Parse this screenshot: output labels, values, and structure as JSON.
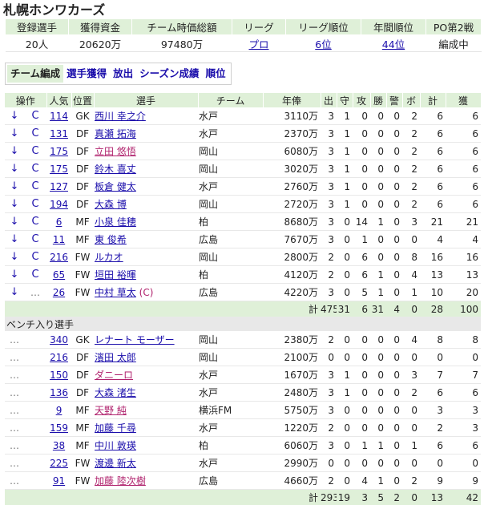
{
  "team_name": "札幌ホンワカーズ",
  "summary": {
    "headers": [
      "登録選手",
      "獲得資金",
      "チーム時価総額",
      "リーグ",
      "リーグ順位",
      "年間順位",
      "PO第2戦"
    ],
    "values": [
      "20人",
      "20620万",
      "97480万",
      "プロ",
      "6位",
      "44位",
      "編成中"
    ]
  },
  "tabs": [
    "チーム編成",
    "選手獲得",
    "放出",
    "シーズン成績",
    "順位"
  ],
  "columns": [
    "操作",
    "人気",
    "位置",
    "選手",
    "チーム",
    "年俸",
    "出",
    "守",
    "攻",
    "勝",
    "警",
    "ボ",
    "計",
    "獲"
  ],
  "starters": [
    {
      "ops": [
        "↓",
        "C"
      ],
      "pop": "114",
      "pos": "GK",
      "name": "西川 幸之介",
      "team": "水戸",
      "salary": "3110万",
      "stats": [
        "3",
        "1",
        "0",
        "0",
        "0",
        "2",
        "6",
        "6"
      ]
    },
    {
      "ops": [
        "↓",
        "C"
      ],
      "pop": "131",
      "pos": "DF",
      "name": "真瀬 拓海",
      "team": "水戸",
      "salary": "2370万",
      "stats": [
        "3",
        "1",
        "0",
        "0",
        "0",
        "2",
        "6",
        "6"
      ]
    },
    {
      "ops": [
        "↓",
        "C"
      ],
      "pop": "175",
      "pos": "DF",
      "name": "立田 悠悟",
      "team": "岡山",
      "salary": "6080万",
      "stats": [
        "3",
        "1",
        "0",
        "0",
        "0",
        "2",
        "6",
        "6"
      ],
      "pink": true
    },
    {
      "ops": [
        "↓",
        "C"
      ],
      "pop": "175",
      "pos": "DF",
      "name": "鈴木 喜丈",
      "team": "岡山",
      "salary": "3020万",
      "stats": [
        "3",
        "1",
        "0",
        "0",
        "0",
        "2",
        "6",
        "6"
      ]
    },
    {
      "ops": [
        "↓",
        "C"
      ],
      "pop": "127",
      "pos": "DF",
      "name": "板倉 健太",
      "team": "水戸",
      "salary": "2760万",
      "stats": [
        "3",
        "1",
        "0",
        "0",
        "0",
        "2",
        "6",
        "6"
      ]
    },
    {
      "ops": [
        "↓",
        "C"
      ],
      "pop": "194",
      "pos": "DF",
      "name": "大森 博",
      "team": "岡山",
      "salary": "2720万",
      "stats": [
        "3",
        "1",
        "0",
        "0",
        "0",
        "2",
        "6",
        "6"
      ]
    },
    {
      "ops": [
        "↓",
        "C"
      ],
      "pop": "6",
      "pos": "MF",
      "name": "小泉 佳穂",
      "team": "柏",
      "salary": "8680万",
      "stats": [
        "3",
        "0",
        "14",
        "1",
        "0",
        "3",
        "21",
        "21"
      ]
    },
    {
      "ops": [
        "↓",
        "C"
      ],
      "pop": "11",
      "pos": "MF",
      "name": "東 俊希",
      "team": "広島",
      "salary": "7670万",
      "stats": [
        "3",
        "0",
        "1",
        "0",
        "0",
        "0",
        "4",
        "4"
      ]
    },
    {
      "ops": [
        "↓",
        "C"
      ],
      "pop": "216",
      "pos": "FW",
      "name": "ルカオ",
      "team": "岡山",
      "salary": "2800万",
      "stats": [
        "2",
        "0",
        "6",
        "0",
        "0",
        "8",
        "16",
        "16"
      ]
    },
    {
      "ops": [
        "↓",
        "C"
      ],
      "pop": "65",
      "pos": "FW",
      "name": "垣田 裕暉",
      "team": "柏",
      "salary": "4120万",
      "stats": [
        "2",
        "0",
        "6",
        "1",
        "0",
        "4",
        "13",
        "13"
      ]
    },
    {
      "ops": [
        "↓",
        "…"
      ],
      "pop": "26",
      "pos": "FW",
      "name": "中村 草太",
      "captain": "(C)",
      "team": "広島",
      "salary": "4220万",
      "stats": [
        "3",
        "0",
        "5",
        "1",
        "0",
        "1",
        "10",
        "20"
      ]
    }
  ],
  "starters_total": {
    "label": "計",
    "salary": "47550万",
    "stats": [
      "31",
      "6",
      "31",
      "4",
      "0",
      "28",
      "100",
      "110"
    ]
  },
  "bench_title": "ベンチ入り選手",
  "bench": [
    {
      "ops": [
        "…",
        ""
      ],
      "pop": "340",
      "pos": "GK",
      "name": "レナート モーザー",
      "team": "岡山",
      "salary": "2380万",
      "stats": [
        "2",
        "0",
        "0",
        "0",
        "0",
        "4",
        "8",
        "8"
      ]
    },
    {
      "ops": [
        "…",
        ""
      ],
      "pop": "216",
      "pos": "DF",
      "name": "濱田 太郎",
      "team": "岡山",
      "salary": "2100万",
      "stats": [
        "0",
        "0",
        "0",
        "0",
        "0",
        "0",
        "0",
        "0"
      ]
    },
    {
      "ops": [
        "…",
        ""
      ],
      "pop": "150",
      "pos": "DF",
      "name": "ダニーロ",
      "team": "水戸",
      "salary": "1670万",
      "stats": [
        "3",
        "1",
        "0",
        "0",
        "0",
        "3",
        "7",
        "7"
      ],
      "pink": true
    },
    {
      "ops": [
        "…",
        ""
      ],
      "pop": "136",
      "pos": "DF",
      "name": "大森 渚生",
      "team": "水戸",
      "salary": "2480万",
      "stats": [
        "3",
        "1",
        "0",
        "0",
        "0",
        "2",
        "6",
        "6"
      ]
    },
    {
      "ops": [
        "…",
        ""
      ],
      "pop": "9",
      "pos": "MF",
      "name": "天野 純",
      "team": "横浜FM",
      "salary": "5750万",
      "stats": [
        "3",
        "0",
        "0",
        "0",
        "0",
        "0",
        "3",
        "3"
      ],
      "pink": true
    },
    {
      "ops": [
        "…",
        ""
      ],
      "pop": "159",
      "pos": "MF",
      "name": "加藤 千尋",
      "team": "水戸",
      "salary": "1220万",
      "stats": [
        "2",
        "0",
        "0",
        "0",
        "0",
        "0",
        "2",
        "3"
      ]
    },
    {
      "ops": [
        "…",
        ""
      ],
      "pop": "38",
      "pos": "MF",
      "name": "中川 敦瑛",
      "team": "柏",
      "salary": "6060万",
      "stats": [
        "3",
        "0",
        "1",
        "1",
        "0",
        "1",
        "6",
        "6"
      ]
    },
    {
      "ops": [
        "…",
        ""
      ],
      "pop": "225",
      "pos": "FW",
      "name": "渡邊 新太",
      "team": "水戸",
      "salary": "2990万",
      "stats": [
        "0",
        "0",
        "0",
        "0",
        "0",
        "0",
        "0",
        "0"
      ]
    },
    {
      "ops": [
        "…",
        ""
      ],
      "pop": "91",
      "pos": "FW",
      "name": "加藤 陸次樹",
      "team": "広島",
      "salary": "4660万",
      "stats": [
        "2",
        "0",
        "4",
        "1",
        "0",
        "2",
        "9",
        "9"
      ],
      "pink": true
    }
  ],
  "bench_total": {
    "label": "計",
    "salary": "29310万",
    "stats": [
      "19",
      "3",
      "5",
      "2",
      "0",
      "13",
      "42",
      "42"
    ]
  }
}
